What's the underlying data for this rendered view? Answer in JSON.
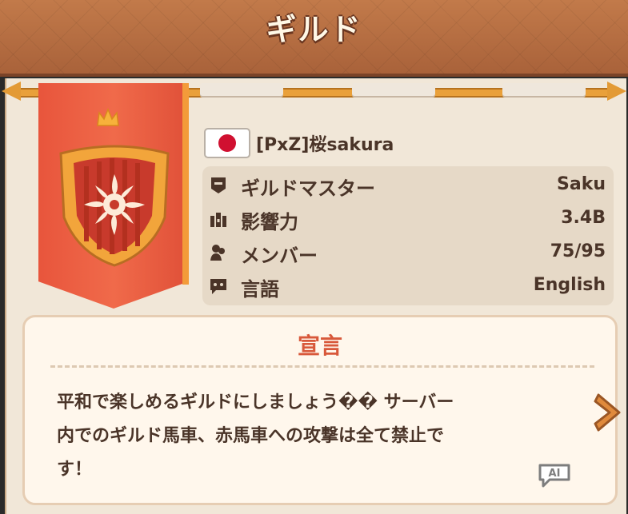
{
  "header": {
    "title": "ギルド"
  },
  "guild": {
    "flag": "japan-flag",
    "name": "[PxZ]桜sakura"
  },
  "info": {
    "rows": [
      {
        "icon": "guild-master-icon",
        "label": "ギルドマスター",
        "value": "Saku"
      },
      {
        "icon": "influence-icon",
        "label": "影響力",
        "value": "3.4B"
      },
      {
        "icon": "members-icon",
        "label": "メンバー",
        "value": "75/95"
      },
      {
        "icon": "language-icon",
        "label": "言語",
        "value": "English"
      }
    ]
  },
  "declaration": {
    "title": "宣言",
    "line1": "平和で楽しめるギルドにしましょう�� サーバー",
    "line2": "内でのギルド馬車、赤馬車への攻撃は全て禁止で",
    "line3": "す！"
  },
  "colors": {
    "banner": "#e8553c",
    "accent": "#d8583a",
    "text": "#4a3428",
    "rail": "#e9a03a"
  }
}
